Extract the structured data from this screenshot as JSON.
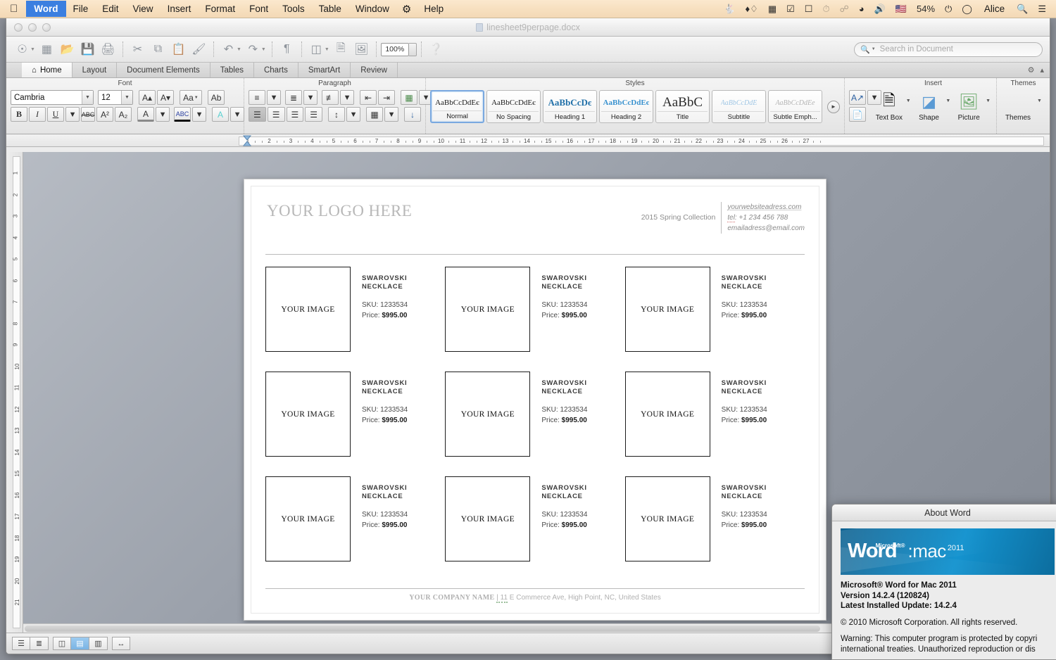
{
  "menubar": {
    "apple_icon": "apple-icon",
    "items": [
      "Word",
      "File",
      "Edit",
      "View",
      "Insert",
      "Format",
      "Font",
      "Tools",
      "Table",
      "Window",
      "Help"
    ],
    "dropbox_icon": "dropbox-icon",
    "status_icons": [
      "evernote-icon",
      "dropbox-icon",
      "alfred-icon",
      "checkmark-box-icon",
      "airplay-icon",
      "time-machine-icon",
      "bluetooth-icon",
      "wifi-icon",
      "volume-icon",
      "flag-us-icon"
    ],
    "battery": "54%",
    "battery_icon": "battery-charging-icon",
    "clock_icon": "clock-icon",
    "user": "Alice",
    "search_icon": "spotlight-search-icon",
    "notification_icon": "notification-center-icon"
  },
  "window": {
    "title": "linesheet9perpage.docx",
    "doc_icon": "word-document-icon"
  },
  "toolbar": {
    "buttons": [
      {
        "name": "new-document-button",
        "glyph": "◯"
      },
      {
        "name": "open-recent-button",
        "glyph": "▦"
      },
      {
        "name": "open-button",
        "glyph": "❐"
      },
      {
        "name": "save-button",
        "glyph": "▣"
      },
      {
        "name": "print-button",
        "glyph": "⎙"
      },
      {
        "name": "cut-button",
        "glyph": "✂"
      },
      {
        "name": "copy-button",
        "glyph": "⧉"
      },
      {
        "name": "paste-button",
        "glyph": "Ὄb"
      },
      {
        "name": "format-painter-button",
        "glyph": "✎"
      },
      {
        "name": "undo-button",
        "glyph": "↶"
      },
      {
        "name": "redo-button",
        "glyph": "↷"
      },
      {
        "name": "show-paragraph-marks-button",
        "glyph": "¶"
      },
      {
        "name": "sidebar-button",
        "glyph": "◫"
      },
      {
        "name": "notebook-layout-button",
        "glyph": "⌸"
      },
      {
        "name": "media-browser-button",
        "glyph": "☰"
      }
    ],
    "zoom_value": "100%",
    "help_icon": "help-icon",
    "search_placeholder": "Search in Document",
    "search_value": "",
    "search_icon": "magnifier-icon"
  },
  "ribbon_tabs": [
    {
      "label": "Home",
      "icon": "home-icon",
      "active": true
    },
    {
      "label": "Layout",
      "active": false
    },
    {
      "label": "Document Elements",
      "active": false
    },
    {
      "label": "Tables",
      "active": false
    },
    {
      "label": "Charts",
      "active": false
    },
    {
      "label": "SmartArt",
      "active": false
    },
    {
      "label": "Review",
      "active": false
    }
  ],
  "ribbon": {
    "font_group": {
      "title": "Font",
      "font_name": "Cambria",
      "font_size": "12",
      "grow_font": "A▴",
      "shrink_font": "A▾",
      "change_case": "Aa",
      "clear_formatting": "Ab",
      "bold": "B",
      "italic": "I",
      "underline": "U",
      "strikethrough": "ABC",
      "superscript": "A²",
      "subscript": "A₂",
      "font_color": "A",
      "highlight": "ABC",
      "text_effects": "A"
    },
    "paragraph_group": {
      "title": "Paragraph",
      "bullets": "bulleted-list-icon",
      "numbering": "numbered-list-icon",
      "multilevel": "multilevel-list-icon",
      "decrease_indent": "decrease-indent-icon",
      "increase_indent": "increase-indent-icon",
      "borders": "borders-icon",
      "align_left": "align-left-icon",
      "align_center": "align-center-icon",
      "align_right": "align-right-icon",
      "justify": "justify-icon",
      "line_spacing": "line-spacing-icon",
      "shading": "shading-icon",
      "sort": "sort-az-icon"
    },
    "styles_group": {
      "title": "Styles",
      "items": [
        {
          "preview": "AaBbCcDdEє",
          "label": "Normal",
          "selected": true
        },
        {
          "preview": "AaBbCcDdEє",
          "label": "No Spacing",
          "selected": false
        },
        {
          "preview": "AaBbCcDє",
          "label": "Heading 1",
          "selected": false
        },
        {
          "preview": "AaBbCcDdEє",
          "label": "Heading 2",
          "selected": false
        },
        {
          "preview": "AaBbC",
          "label": "Title",
          "selected": false
        },
        {
          "preview": "AaBbCcDdE",
          "label": "Subtitle",
          "selected": false
        },
        {
          "preview": "AaBbCcDdEe",
          "label": "Subtle Emph...",
          "selected": false
        }
      ],
      "more_icon": "gallery-more-icon"
    },
    "insert_group": {
      "title": "Insert",
      "items": [
        {
          "label": "Text Box",
          "icon": "text-box-icon"
        },
        {
          "label": "Shape",
          "icon": "shape-icon"
        },
        {
          "label": "Picture",
          "icon": "picture-icon"
        }
      ],
      "quick_styles_icon": "quick-styles-icon",
      "citations_icon": "citations-icon"
    },
    "themes_group": {
      "title": "Themes",
      "label": "Themes",
      "icon": "themes-icon"
    }
  },
  "ruler": {
    "h_numbers": [
      "1",
      "2",
      "3",
      "4",
      "5",
      "6",
      "7",
      "8",
      "9",
      "10",
      "11",
      "12",
      "13",
      "14",
      "15",
      "16",
      "17",
      "18",
      "19",
      "20",
      "21",
      "22",
      "23",
      "24",
      "25",
      "26",
      "27"
    ],
    "v_numbers": [
      "1",
      "2",
      "3",
      "4",
      "5",
      "6",
      "7",
      "8",
      "9",
      "10",
      "11",
      "12",
      "13",
      "14",
      "15",
      "16",
      "17",
      "18",
      "19",
      "20",
      "21"
    ]
  },
  "document": {
    "logo": "YOUR LOGO HERE",
    "collection": "2015 Spring Collection",
    "contact": {
      "website": "yourwebsiteadress.com",
      "tel_label": "tel",
      "tel": ": +1 234 456 788",
      "email": "emailadress@email.com"
    },
    "image_placeholder": "YOUR IMAGE",
    "products": [
      [
        {
          "name": "SWAROVSKI NECKLACE",
          "sku_label": "SKU:",
          "sku": "1233534",
          "price_label": "Price:",
          "price": "$995.00"
        },
        {
          "name": "SWAROVSKI NECKLACE",
          "sku_label": "SKU:",
          "sku": "1233534",
          "price_label": "Price:",
          "price": "$995.00"
        },
        {
          "name": "SWAROVSKI NECKLACE",
          "sku_label": "SKU:",
          "sku": "1233534",
          "price_label": "Price:",
          "price": "$995.00"
        }
      ],
      [
        {
          "name": "SWAROVSKI NECKLACE",
          "sku_label": "SKU:",
          "sku": "1233534",
          "price_label": "Price:",
          "price": "$995.00"
        },
        {
          "name": "SWAROVSKI NECKLACE",
          "sku_label": "SKU:",
          "sku": "1233534",
          "price_label": "Price:",
          "price": "$995.00"
        },
        {
          "name": "SWAROVSKI NECKLACE",
          "sku_label": "SKU:",
          "sku": "1233534",
          "price_label": "Price:",
          "price": "$995.00"
        }
      ],
      [
        {
          "name": "SWAROVSKI NECKLACE",
          "sku_label": "SKU:",
          "sku": "1233534",
          "price_label": "Price:",
          "price": "$995.00"
        },
        {
          "name": "SWAROVSKI NECKLACE",
          "sku_label": "SKU:",
          "sku": "1233534",
          "price_label": "Price:",
          "price": "$995.00"
        },
        {
          "name": "SWAROVSKI NECKLACE",
          "sku_label": "SKU:",
          "sku": "1233534",
          "price_label": "Price:",
          "price": "$995.00"
        }
      ]
    ],
    "footer": {
      "company": "YOUR COMPANY NAME",
      "separator": "| 11",
      "address": "E Commerce Ave, High Point, NC, United States"
    }
  },
  "statusbar": {
    "views": [
      {
        "name": "draft-view-button",
        "icon": "draft-view-icon",
        "active": false
      },
      {
        "name": "outline-view-button",
        "icon": "outline-view-icon",
        "active": false
      },
      {
        "name": "publishing-layout-button",
        "icon": "publishing-layout-icon",
        "active": false
      },
      {
        "name": "print-layout-button",
        "icon": "print-layout-icon",
        "active": true
      },
      {
        "name": "notebook-layout-button",
        "icon": "notebook-layout-icon",
        "active": false
      },
      {
        "name": "full-screen-button",
        "icon": "full-screen-icon",
        "active": false
      }
    ]
  },
  "about_dialog": {
    "title": "About Word",
    "wordmark": {
      "ms": "Microsoft®",
      "word": "Word",
      "mac": ":mac",
      "year": "2011"
    },
    "product": "Microsoft® Word for Mac 2011",
    "version": "Version 14.2.4 (120824)",
    "update": "Latest Installed Update: 14.2.4",
    "copyright": "© 2010 Microsoft Corporation. All rights reserved.",
    "warning_line1": "Warning: This computer program is protected by copyri",
    "warning_line2": "international treaties.  Unauthorized reproduction or dis"
  },
  "colors": {
    "menubar_accent": "#3b7fe0",
    "page_bg": "#ffffff",
    "desktop": "#8d9199",
    "wordmark_blue": "#0e7cb4"
  }
}
